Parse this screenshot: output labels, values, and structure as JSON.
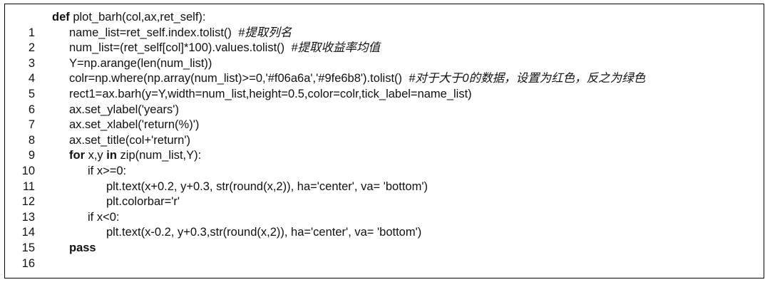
{
  "editor": {
    "lines": [
      {
        "number": "1",
        "segments": {
          "keyword": "def",
          "text": " plot_barh(col,ax,ret_self):"
        }
      },
      {
        "number": "2",
        "segments": {
          "text": "name_list=ret_self.index.tolist()  ",
          "comment": "#提取列名"
        }
      },
      {
        "number": "3",
        "segments": {
          "text": "num_list=(ret_self[col]*100).values.tolist()  ",
          "comment": "#提取收益率均值"
        }
      },
      {
        "number": "4",
        "segments": {
          "text": "Y=np.arange(len(num_list))"
        }
      },
      {
        "number": "5",
        "segments": {
          "text": "colr=np.where(np.array(num_list)>=0,'#f06a6a','#9fe6b8').tolist()  ",
          "comment": "#对于大于0的数据，设置为红色，反之为绿色"
        }
      },
      {
        "number": "6",
        "segments": {
          "text": "rect1=ax.barh(y=Y,width=num_list,height=0.5,color=colr,tick_label=name_list)"
        }
      },
      {
        "number": "7",
        "segments": {
          "text": "ax.set_ylabel('years')"
        }
      },
      {
        "number": "8",
        "segments": {
          "text": "ax.set_xlabel('return(%)')"
        }
      },
      {
        "number": "9",
        "segments": {
          "text": "ax.set_title(col+'return')"
        }
      },
      {
        "number": "10",
        "segments": {
          "keyword": "for",
          "text": " x,y ",
          "keyword2": "in",
          "text2": " zip(num_list,Y):"
        }
      },
      {
        "number": "11",
        "segments": {
          "text": "if x>=0:"
        }
      },
      {
        "number": "12",
        "segments": {
          "text": "plt.text(x+0.2, y+0.3, str(round(x,2)), ha='center', va= 'bottom')"
        }
      },
      {
        "number": "13",
        "segments": {
          "text": "plt.colorbar='r'"
        }
      },
      {
        "number": "14",
        "segments": {
          "text": "if x<0:"
        }
      },
      {
        "number": "15",
        "segments": {
          "text": "plt.text(x-0.2, y+0.3,str(round(x,2)), ha='center', va= 'bottom')"
        }
      },
      {
        "number": "16",
        "segments": {
          "text": "pass"
        }
      }
    ]
  }
}
